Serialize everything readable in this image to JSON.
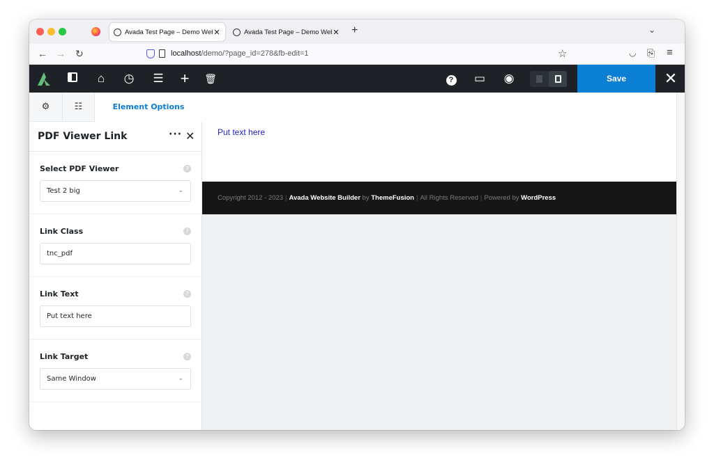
{
  "browser": {
    "tabs": [
      {
        "label": "Avada Test Page – Demo Websi"
      },
      {
        "label": "Avada Test Page – Demo Websi"
      }
    ],
    "url_host": "localhost",
    "url_path": "/demo/?page_id=278&fb-edit=1"
  },
  "toolbar": {
    "save_label": "Save",
    "accent": "#0a7fd3"
  },
  "sidebar": {
    "active_tab": "Element Options",
    "element_title": "PDF Viewer Link",
    "options": [
      {
        "label": "Select PDF Viewer",
        "value": "Test 2 big",
        "type": "select"
      },
      {
        "label": "Link Class",
        "value": "tnc_pdf",
        "type": "text"
      },
      {
        "label": "Link Text",
        "value": "Put text here",
        "type": "text"
      },
      {
        "label": "Link Target",
        "value": "Same Window",
        "type": "select"
      }
    ]
  },
  "content": {
    "link_text": "Put text here",
    "footer": {
      "prefix": "Copyright 2012 - 2023",
      "builder": "Avada Website Builder",
      "by": "by",
      "company": "ThemeFusion",
      "rights": "All Rights Reserved",
      "powered": "Powered by",
      "platform": "WordPress"
    }
  }
}
